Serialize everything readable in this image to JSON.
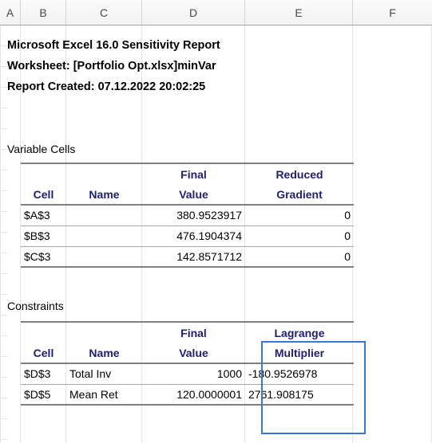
{
  "spreadsheet": {
    "column_headers": [
      "A",
      "B",
      "C",
      "D",
      "E",
      "F"
    ]
  },
  "report_header": {
    "line1": "Microsoft Excel 16.0 Sensitivity Report",
    "line2": "Worksheet: [Portfolio Opt.xlsx]minVar",
    "line3": "Report Created: 07.12.2022 20:02:25"
  },
  "variable_cells": {
    "section_label": "Variable Cells",
    "headers": {
      "cell": "Cell",
      "name": "Name",
      "value_line1": "Final",
      "value_line2": "Value",
      "extra_line1": "Reduced",
      "extra_line2": "Gradient"
    },
    "rows": [
      {
        "cell": "$A$3",
        "name": "",
        "final_value": "380.9523917",
        "reduced_gradient": "0"
      },
      {
        "cell": "$B$3",
        "name": "",
        "final_value": "476.1904374",
        "reduced_gradient": "0"
      },
      {
        "cell": "$C$3",
        "name": "",
        "final_value": "142.8571712",
        "reduced_gradient": "0"
      }
    ]
  },
  "constraints": {
    "section_label": "Constraints",
    "headers": {
      "cell": "Cell",
      "name": "Name",
      "value_line1": "Final",
      "value_line2": "Value",
      "extra_line1": "Lagrange",
      "extra_line2": "Multiplier"
    },
    "rows": [
      {
        "cell": "$D$3",
        "name": "Total Inv",
        "final_value": "1000",
        "lagrange_multiplier": "-180.9526978"
      },
      {
        "cell": "$D$5",
        "name": "Mean Ret",
        "final_value": "120.0000001",
        "lagrange_multiplier": "2761.908175"
      }
    ]
  },
  "colors": {
    "header_text": "#1f2170",
    "selection_border": "#3a77e0",
    "rule_strong": "#808080",
    "rule_light": "#a8a8a8"
  }
}
